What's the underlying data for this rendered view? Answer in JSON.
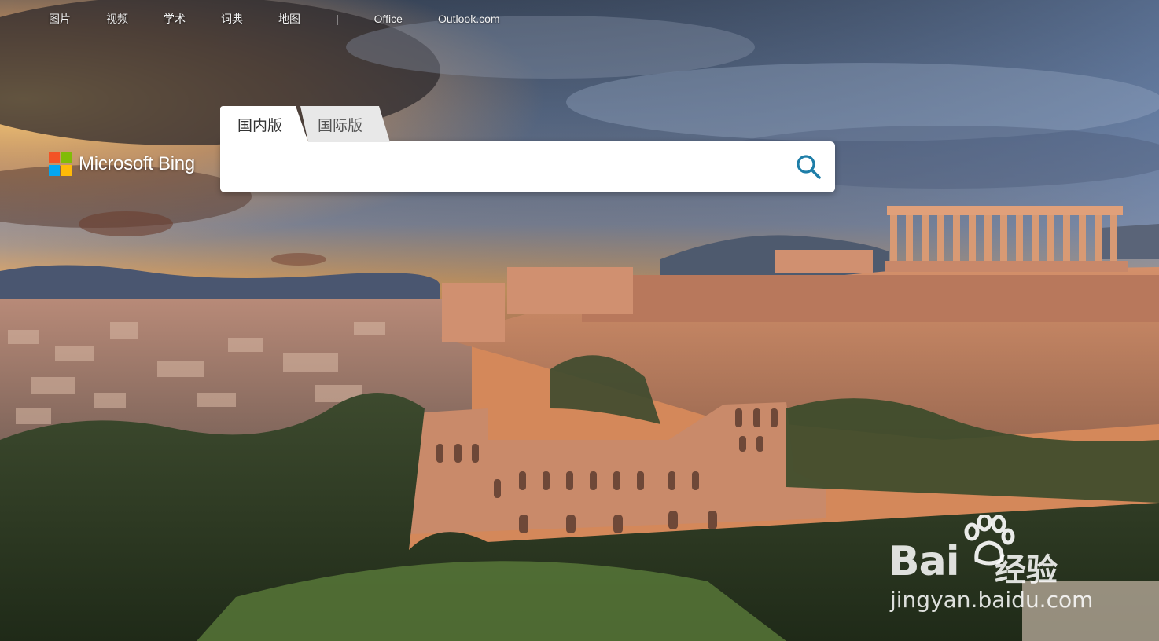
{
  "topnav": {
    "items": [
      "图片",
      "视频",
      "学术",
      "词典",
      "地图"
    ],
    "separator": "|",
    "links": [
      "Office",
      "Outlook.com"
    ]
  },
  "logo": {
    "text": "Microsoft Bing"
  },
  "tabs": {
    "domestic": "国内版",
    "international": "国际版"
  },
  "search": {
    "value": "",
    "placeholder": ""
  },
  "watermark": {
    "brand": "Bai",
    "brand_tail": "经验",
    "url": "jingyan.baidu.com"
  },
  "icons": {
    "search": "search-icon",
    "logo": "microsoft-logo-icon",
    "paw": "baidu-paw-icon"
  },
  "colors": {
    "ms_red": "#f35325",
    "ms_green": "#81bc06",
    "ms_blue": "#05a6f0",
    "ms_yellow": "#ffba08",
    "search_icon": "#1e7ea8"
  }
}
